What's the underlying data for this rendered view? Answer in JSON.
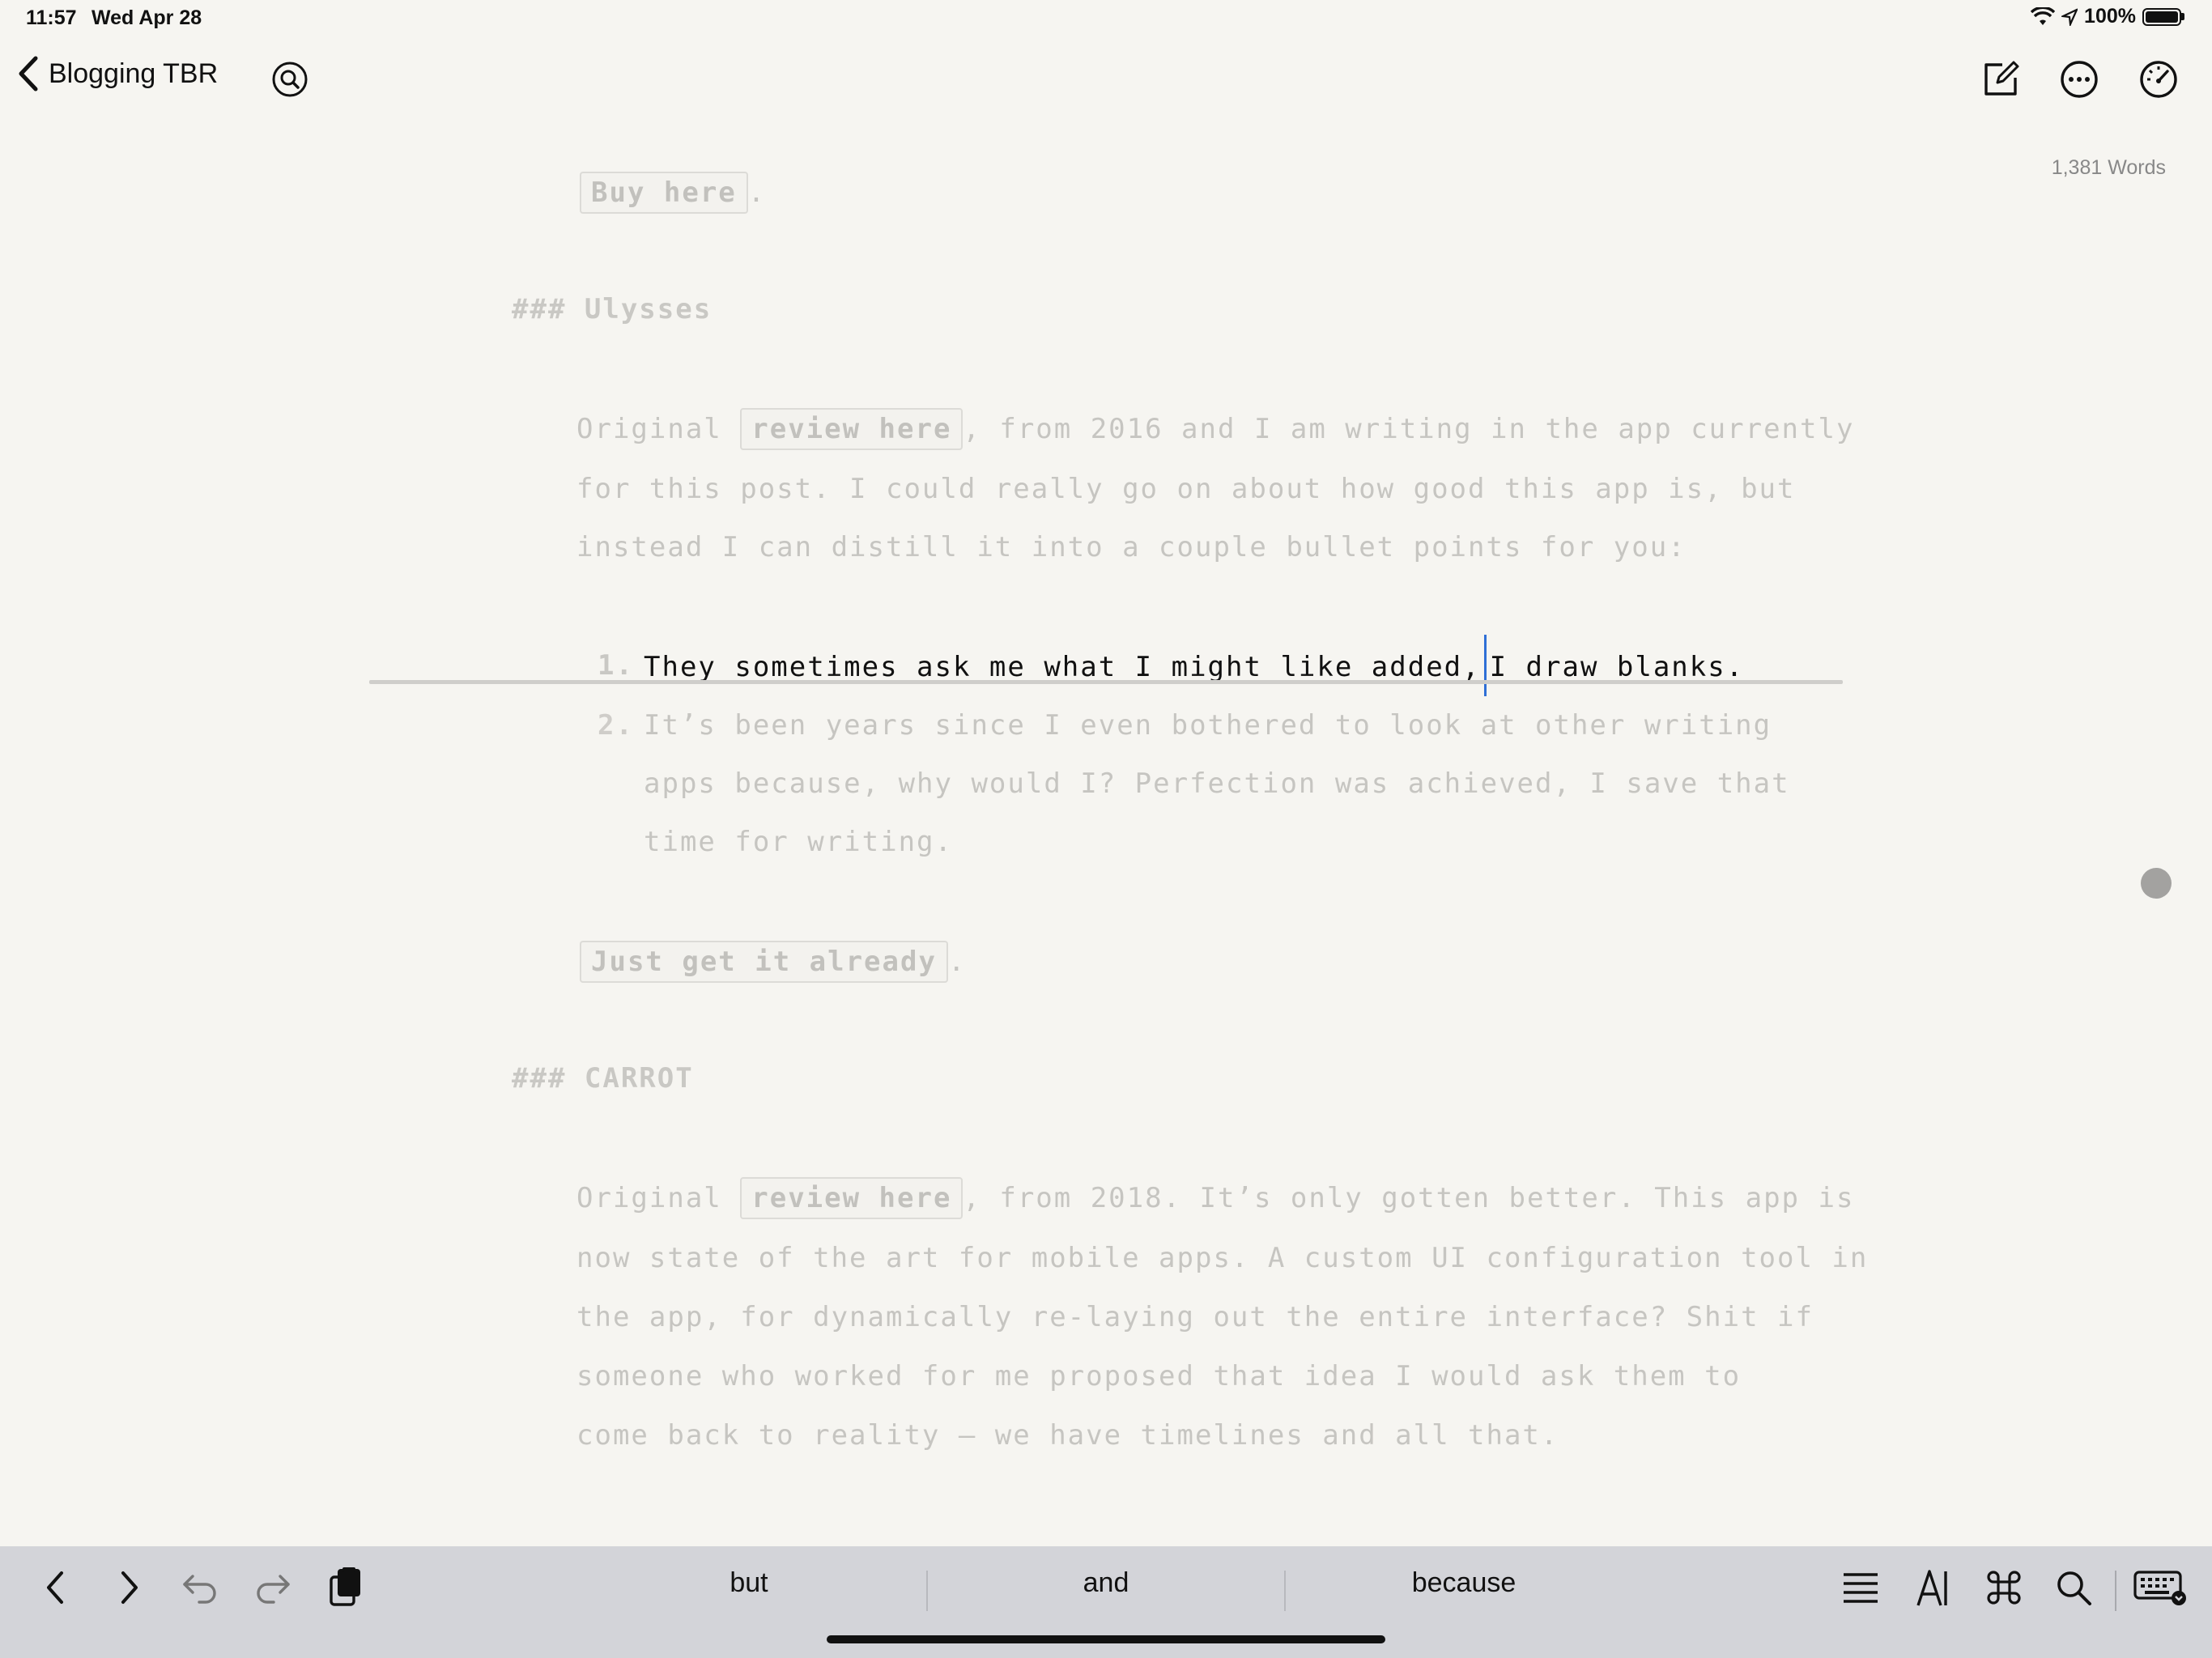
{
  "status": {
    "time": "11:57",
    "date": "Wed Apr 28",
    "battery": "100%"
  },
  "nav": {
    "back_label": "Blogging TBR",
    "word_count": "1,381 Words"
  },
  "icons": [
    "chevron-left-icon",
    "search-icon",
    "compose-icon",
    "more-icon",
    "dashboard-icon",
    "wifi-icon",
    "location-icon",
    "battery-icon"
  ],
  "editor": {
    "tag_buy": "Buy here",
    "period": ".",
    "heading_ulysses": "### Ulysses",
    "p1_l1_a": "Original",
    "tag_review": "review here",
    "p1_l1_b": ", from 2016 and I am writing in the app currently",
    "p1_l2": "for this post. I could really go on about how good this app is, but",
    "p1_l3": "instead I can distill it into a couple bullet points for you:",
    "li1_num": "1.",
    "li1_before": "They sometimes ask me what I might like added,",
    "li1_after": "I draw blanks.",
    "li2_num": "2.",
    "li2_l1": "It’s been years since I even bothered to look at other writing",
    "li2_l2": "apps because, why would I? Perfection was achieved, I save that",
    "li2_l3": "time for writing.",
    "tag_get": "Just get it already",
    "heading_carrot": "### CARROT",
    "p2_l1_a": "Original",
    "p2_l1_b": ", from 2018. It’s only gotten better. This app is",
    "p2_l2": "now state of the art for mobile apps. A custom UI configuration tool in",
    "p2_l3": "the app, for dynamically re-laying out the entire interface? Shit if",
    "p2_l4": "someone who worked for me proposed that idea I would ask them to",
    "p2_l5": "come back to reality — we have timelines and all that."
  },
  "suggestions": [
    "but",
    "and",
    "because"
  ]
}
